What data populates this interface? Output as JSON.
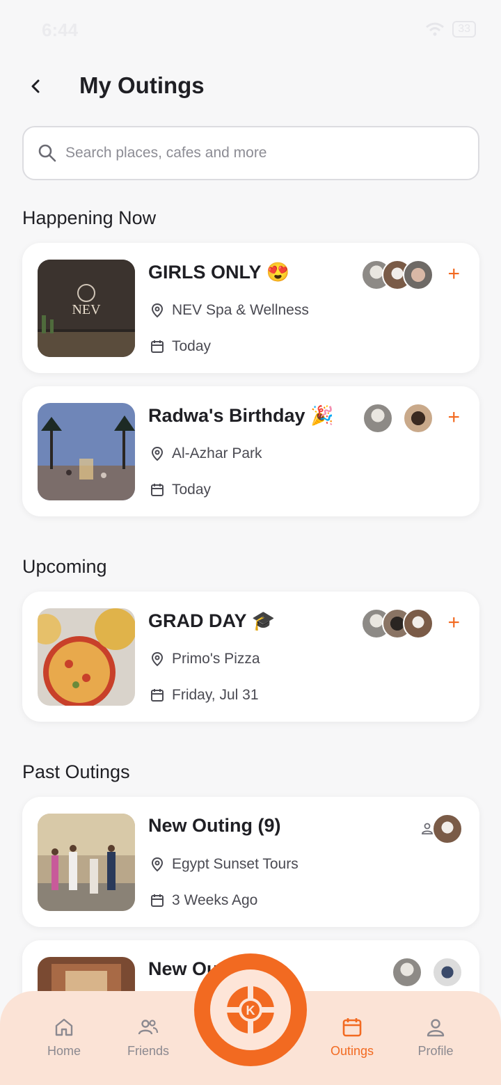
{
  "status": {
    "time": "6:44",
    "battery": "33"
  },
  "header": {
    "title": "My Outings"
  },
  "search": {
    "placeholder": "Search places, cafes and more"
  },
  "sections": {
    "now": "Happening Now",
    "upcoming": "Upcoming",
    "past": "Past Outings"
  },
  "cards": [
    {
      "title": "GIRLS ONLY 😍",
      "place": "NEV Spa & Wellness",
      "date": "Today"
    },
    {
      "title": "Radwa's Birthday 🎉",
      "place": "Al-Azhar Park",
      "date": "Today"
    },
    {
      "title": "GRAD DAY 🎓",
      "place": "Primo's Pizza",
      "date": "Friday, Jul 31"
    },
    {
      "title": "New Outing (9)",
      "place": "Egypt Sunset Tours",
      "date": "3 Weeks Ago"
    },
    {
      "title": "New Ou",
      "place": "",
      "date": ""
    }
  ],
  "add_symbol": "+",
  "nav": {
    "home": "Home",
    "friends": "Friends",
    "outings": "Outings",
    "profile": "Profile",
    "logo_letter": "K"
  },
  "colors": {
    "accent": "#f26a21",
    "nav_bg": "#fbe3d6"
  }
}
